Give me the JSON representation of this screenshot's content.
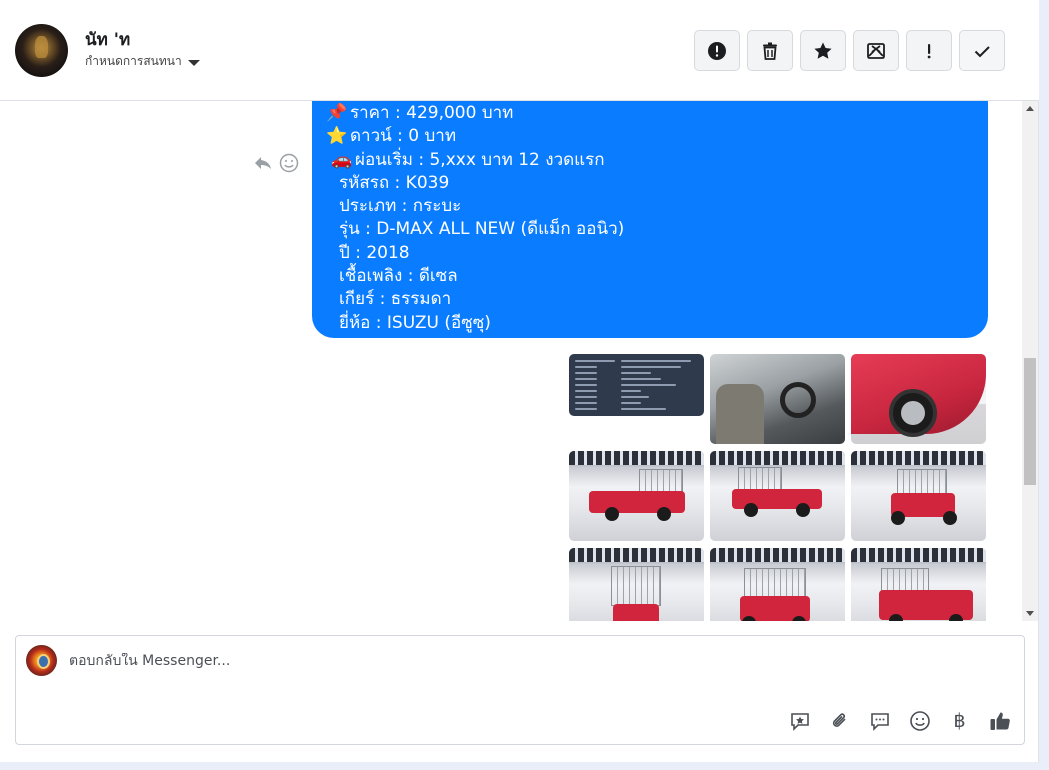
{
  "header": {
    "contact_name": "นัท 'ท",
    "assign_label": "กำหนดการสนทนา",
    "actions": [
      {
        "name": "report-button",
        "icon": "alert-circle-icon"
      },
      {
        "name": "delete-button",
        "icon": "trash-icon"
      },
      {
        "name": "star-button",
        "icon": "star-icon"
      },
      {
        "name": "mark-unread-button",
        "icon": "envelope-x-icon"
      },
      {
        "name": "important-button",
        "icon": "exclamation-icon"
      },
      {
        "name": "done-button",
        "icon": "check-icon"
      }
    ]
  },
  "message": {
    "lines": [
      {
        "emoji": "📌",
        "text": "ราคา : 429,000 บาท"
      },
      {
        "emoji": "⭐",
        "text": "ดาวน์ : 0 บาท"
      },
      {
        "emoji": "🚗",
        "text": "ผ่อนเริ่ม : 5,xxx บาท 12 งวดแรก"
      },
      {
        "emoji": "",
        "text": "รหัสรถ : K039"
      },
      {
        "emoji": "",
        "text": "ประเภท : กระบะ"
      },
      {
        "emoji": "",
        "text": "รุ่น : D-MAX ALL NEW (ดีแม็ก ออนิว)"
      },
      {
        "emoji": "",
        "text": "ปี : 2018"
      },
      {
        "emoji": "",
        "text": "เชื้อเพลิง : ดีเซล"
      },
      {
        "emoji": "",
        "text": "เกียร์ : ธรรมดา"
      },
      {
        "emoji": "",
        "text": "ยี่ห้อ : ISUZU (อีซูซุ)"
      }
    ],
    "bubble_color": "#0a7cff"
  },
  "message_tools": {
    "reply_icon": "reply-icon",
    "react_icon": "smiley-icon"
  },
  "composer": {
    "placeholder": "ตอบกลับใน Messenger...",
    "tools": [
      "saved-reply-icon",
      "paperclip-icon",
      "chat-bubble-icon",
      "emoji-icon",
      "baht-icon",
      "thumbs-up-icon"
    ],
    "baht_symbol": "฿"
  }
}
